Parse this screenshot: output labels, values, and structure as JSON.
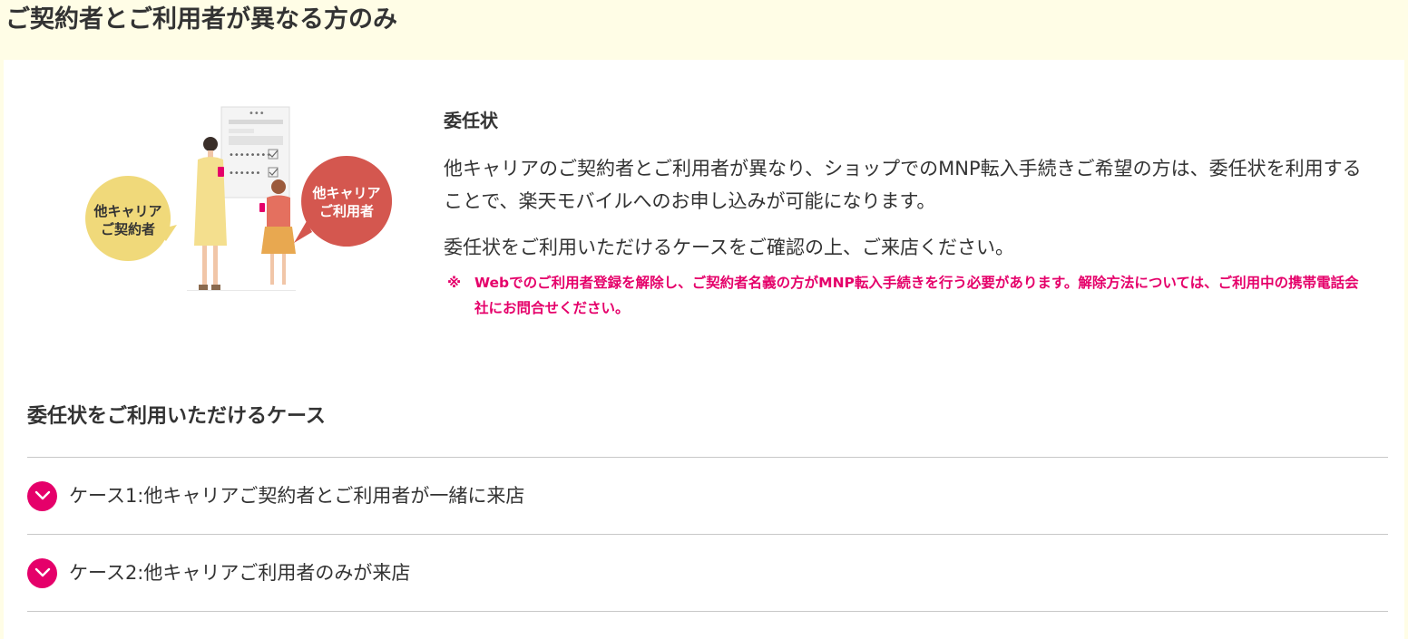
{
  "header": {
    "title": "ご契約者とご利用者が異なる方のみ"
  },
  "illustration": {
    "contract_holder_label_line1": "他キャリア",
    "contract_holder_label_line2": "ご契約者",
    "user_label_line1": "他キャリア",
    "user_label_line2": "ご利用者",
    "form_dots_1": "••••••••",
    "form_dots_2": "••••••",
    "form_header_dots": "•••"
  },
  "mandate": {
    "title": "委任状",
    "body": "他キャリアのご契約者とご利用者が異なり、ショップでのMNP転入手続きご希望の方は、委任状を利用することで、楽天モバイルへのお申し込みが可能になります。",
    "body2": "委任状をご利用いただけるケースをご確認の上、ご来店ください。",
    "note_mark": "※",
    "note_text": "Webでのご利用者登録を解除し、ご契約者名義の方がMNP転入手続きを行う必要があります。解除方法については、ご利用中の携帯電話会社にお問合せください。"
  },
  "cases": {
    "heading": "委任状をご利用いただけるケース",
    "items": [
      {
        "label": "ケース1:他キャリアご契約者とご利用者が一緒に来店",
        "icon": "chevron-down-icon"
      },
      {
        "label": "ケース2:他キャリアご利用者のみが来店",
        "icon": "chevron-down-icon"
      }
    ]
  },
  "colors": {
    "accent": "#e5006a",
    "header_bg": "#fffde6",
    "yellow_bubble": "#f0d97a",
    "red_bubble": "#d4574f"
  }
}
